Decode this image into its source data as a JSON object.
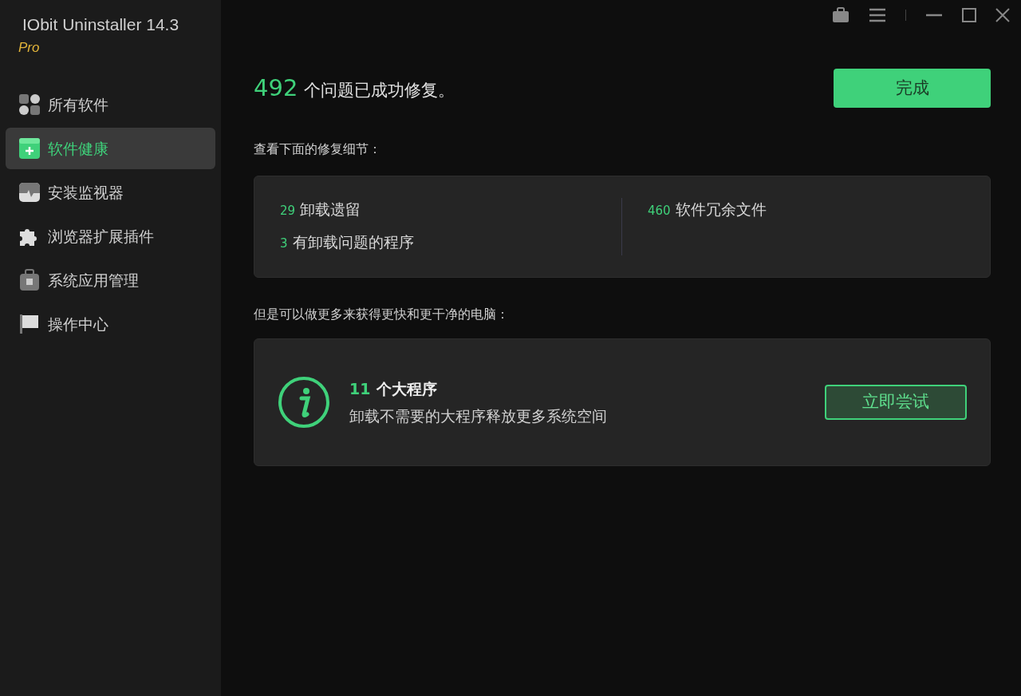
{
  "app": {
    "title": "IObit Uninstaller 14.3",
    "edition": "Pro"
  },
  "sidebar": {
    "items": [
      {
        "label": "所有软件",
        "kind": "apps",
        "selected": false
      },
      {
        "label": "软件健康",
        "kind": "health",
        "selected": true
      },
      {
        "label": "安装监视器",
        "kind": "monitor",
        "selected": false
      },
      {
        "label": "浏览器扩展插件",
        "kind": "extension",
        "selected": false
      },
      {
        "label": "系统应用管理",
        "kind": "system",
        "selected": false
      },
      {
        "label": "操作中心",
        "kind": "action",
        "selected": false
      }
    ]
  },
  "result": {
    "count": "492",
    "message": "个问题已成功修复。",
    "done_button": "完成"
  },
  "details": {
    "heading": "查看下面的修复细节：",
    "columns": [
      [
        {
          "count": "29",
          "label": "卸载遗留"
        },
        {
          "count": "3",
          "label": "有卸载问题的程序"
        }
      ],
      [
        {
          "count": "460",
          "label": "软件冗余文件"
        }
      ]
    ]
  },
  "suggestion": {
    "heading": "但是可以做更多来获得更快和更干净的电脑：",
    "count": "11",
    "title": "个大程序",
    "description": "卸载不需要的大程序释放更多系统空间",
    "button": "立即尝试"
  }
}
